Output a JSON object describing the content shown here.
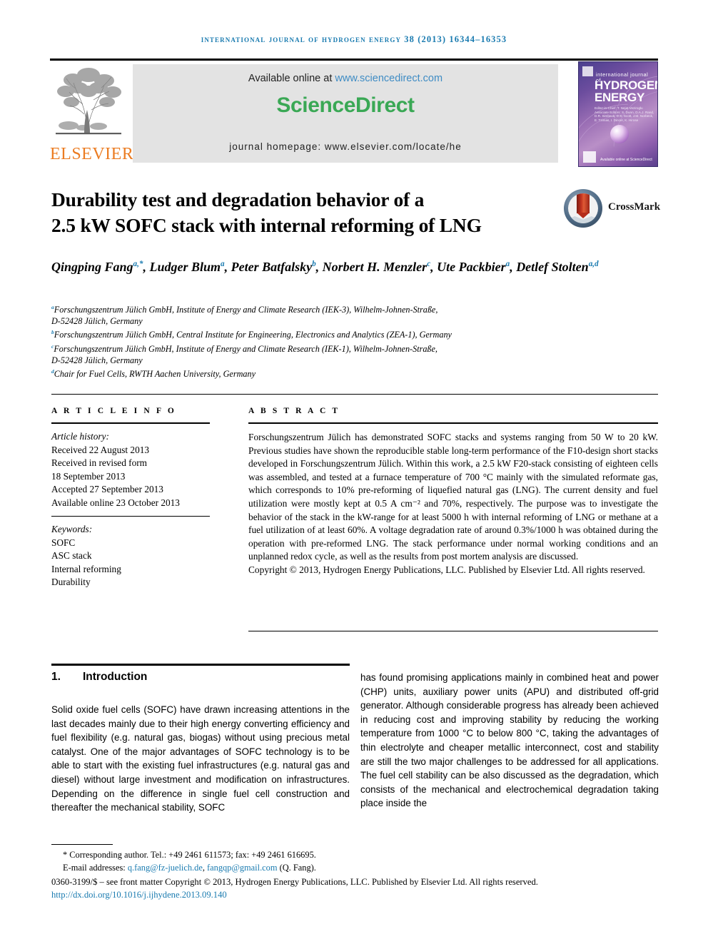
{
  "running_head": "international journal of hydrogen energy 38 (2013) 16344–16353",
  "masthead": {
    "publisher_name": "ELSEVIER",
    "available_prefix": "Available online at ",
    "available_url": "www.sciencedirect.com",
    "wordmark_science": "Science",
    "wordmark_direct": "Direct",
    "journal_homepage": "journal homepage: www.elsevier.com/locate/he",
    "cover": {
      "kicker": "international journal of",
      "title_line1": "HYDROGEN",
      "title_line2": "ENERGY",
      "editors": "Editor-in-Chief: T. Nejat Veziroglu\nAssociate Editors: S. Dunn, D.A.J. Rand, D.R. Simbeck,\nD.S. Scott, J.M. Norbeck, E. Tzimas, I. Dincer, K. Hirose",
      "sciencedirect_label": "Available online at ScienceDirect"
    }
  },
  "article": {
    "title_line1": "Durability test and degradation behavior of a",
    "title_line2": "2.5 kW SOFC stack with internal reforming of LNG",
    "crossmark_label": "CrossMark",
    "authors": [
      {
        "name": "Qingping Fang",
        "sup": "a,*"
      },
      {
        "name": "Ludger Blum",
        "sup": "a"
      },
      {
        "name": "Peter Batfalsky",
        "sup": "b"
      },
      {
        "name": "Norbert H. Menzler",
        "sup": "c"
      },
      {
        "name": "Ute Packbier",
        "sup": "a"
      },
      {
        "name": "Detlef Stolten",
        "sup": "a,d"
      }
    ],
    "affiliations": [
      {
        "sup": "a",
        "lines": [
          "Forschungszentrum Jülich GmbH, Institute of Energy and Climate Research (IEK-3), Wilhelm-Johnen-Straße,",
          "D-52428 Jülich, Germany"
        ]
      },
      {
        "sup": "b",
        "lines": [
          "Forschungszentrum Jülich GmbH, Central Institute for Engineering, Electronics and Analytics (ZEA-1), Germany"
        ]
      },
      {
        "sup": "c",
        "lines": [
          "Forschungszentrum Jülich GmbH, Institute of Energy and Climate Research (IEK-1), Wilhelm-Johnen-Straße,",
          "D-52428 Jülich, Germany"
        ]
      },
      {
        "sup": "d",
        "lines": [
          "Chair for Fuel Cells, RWTH Aachen University, Germany"
        ]
      }
    ]
  },
  "article_info": {
    "heading": "A R T I C L E   I N F O",
    "history_label": "Article history:",
    "history": [
      "Received 22 August 2013",
      "Received in revised form",
      "18 September 2013",
      "Accepted 27 September 2013",
      "Available online 23 October 2013"
    ],
    "keywords_label": "Keywords:",
    "keywords": [
      "SOFC",
      "ASC stack",
      "Internal reforming",
      "Durability"
    ]
  },
  "abstract": {
    "heading": "A B S T R A C T",
    "text": "Forschungszentrum Jülich has demonstrated SOFC stacks and systems ranging from 50 W to 20 kW. Previous studies have shown the reproducible stable long-term performance of the F10-design short stacks developed in Forschungszentrum Jülich. Within this work, a 2.5 kW F20-stack consisting of eighteen cells was assembled, and tested at a furnace temperature of 700 °C mainly with the simulated reformate gas, which corresponds to 10% pre-reforming of liquefied natural gas (LNG). The current density and fuel utilization were mostly kept at 0.5 A cm⁻² and 70%, respectively. The purpose was to investigate the behavior of the stack in the kW-range for at least 5000 h with internal reforming of LNG or methane at a fuel utilization of at least 60%. A voltage degradation rate of around 0.3%/1000 h was obtained during the operation with pre-reformed LNG. The stack performance under normal working conditions and an unplanned redox cycle, as well as the results from post mortem analysis are discussed.",
    "copyright": "Copyright © 2013, Hydrogen Energy Publications, LLC. Published by Elsevier Ltd. All rights reserved."
  },
  "body": {
    "section_number": "1.",
    "section_title": "Introduction",
    "left_column": "Solid oxide fuel cells (SOFC) have drawn increasing attentions in the last decades mainly due to their high energy converting efficiency and fuel flexibility (e.g. natural gas, biogas) without using precious metal catalyst. One of the major advantages of SOFC technology is to be able to start with the existing fuel infrastructures (e.g. natural gas and diesel) without large investment and modification on infrastructures. Depending on the difference in single fuel cell construction and thereafter the mechanical stability, SOFC",
    "right_column": "has found promising applications mainly in combined heat and power (CHP) units, auxiliary power units (APU) and distributed off-grid generator. Although considerable progress has already been achieved in reducing cost and improving stability by reducing the working temperature from 1000 °C to below 800 °C, taking the advantages of thin electrolyte and cheaper metallic interconnect, cost and stability are still the two major challenges to be addressed for all applications. The fuel cell stability can be also discussed as the degradation, which consists of the mechanical and electrochemical degradation taking place inside the"
  },
  "footnotes": {
    "corresponding": "* Corresponding author. Tel.: +49 2461 611573; fax: +49 2461 616695.",
    "email_label": "E-mail addresses: ",
    "email1": "q.fang@fz-juelich.de",
    "email_sep": ", ",
    "email2": "fangqp@gmail.com",
    "email_suffix": " (Q. Fang).",
    "issn_line": "0360-3199/$ – see front matter Copyright © 2013, Hydrogen Energy Publications, LLC. Published by Elsevier Ltd. All rights reserved.",
    "doi": "http://dx.doi.org/10.1016/j.ijhydene.2013.09.140"
  },
  "colors": {
    "link_blue": "#1a7bb0",
    "elsevier_orange": "#eb7c22",
    "sciencedirect_green": "#3aa855",
    "banner_gray": "#e3e3e3"
  }
}
